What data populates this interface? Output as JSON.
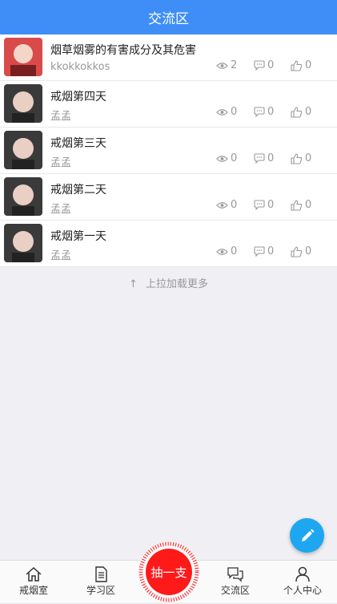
{
  "header": {
    "title": "交流区"
  },
  "posts": [
    {
      "title": "烟草烟雾的有害成分及其危害",
      "author": "kkokkokkos",
      "views": "2",
      "comments": "0",
      "likes": "0"
    },
    {
      "title": "戒烟第四天",
      "author": "孟孟",
      "views": "0",
      "comments": "0",
      "likes": "0"
    },
    {
      "title": "戒烟第三天",
      "author": "孟孟",
      "views": "0",
      "comments": "0",
      "likes": "0"
    },
    {
      "title": "戒烟第二天",
      "author": "孟孟",
      "views": "0",
      "comments": "0",
      "likes": "0"
    },
    {
      "title": "戒烟第一天",
      "author": "孟孟",
      "views": "0",
      "comments": "0",
      "likes": "0"
    }
  ],
  "load_more": {
    "arrow": "↑",
    "text": "上拉加载更多"
  },
  "tabbar": {
    "items": [
      {
        "label": "戒烟室",
        "icon": "home-icon"
      },
      {
        "label": "学习区",
        "icon": "document-icon"
      },
      {
        "label": "交流区",
        "icon": "chat-icon"
      },
      {
        "label": "个人中心",
        "icon": "person-icon"
      }
    ],
    "center_label": "抽一支"
  },
  "colors": {
    "header": "#3f8ef8",
    "fab": "#1ea7f0",
    "center": "#ff1a1a"
  }
}
